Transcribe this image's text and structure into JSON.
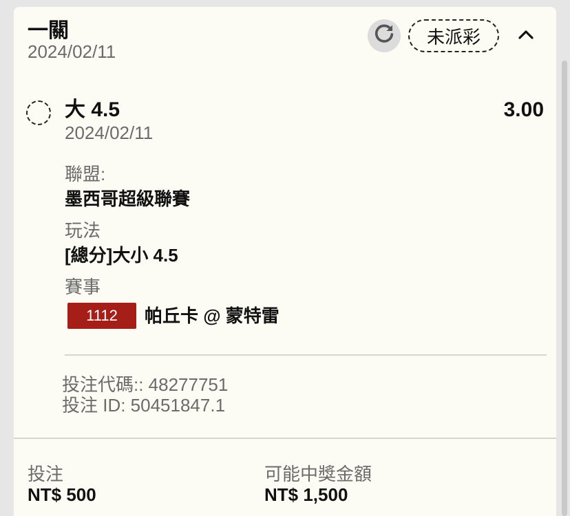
{
  "header": {
    "title": "一關",
    "date": "2024/02/11",
    "status": "未派彩"
  },
  "pick": {
    "name": "大 4.5",
    "odds": "3.00",
    "date": "2024/02/11"
  },
  "details": {
    "league_label": "聯盟:",
    "league_value": "墨西哥超級聯賽",
    "market_label": "玩法",
    "market_value": "[總分]大小 4.5",
    "event_label": "賽事",
    "event_id": "1112",
    "event_name": "帕丘卡 @ 蒙特雷"
  },
  "bet_info": {
    "code": "投注代碼:: 48277751",
    "id": "投注 ID: 50451847.1"
  },
  "footer": {
    "stake_label": "投注",
    "stake_value": "NT$ 500",
    "payout_label": "可能中獎金額",
    "payout_value": "NT$ 1,500"
  },
  "icons": {
    "refresh": "refresh-icon",
    "collapse": "chevron-up-icon"
  },
  "colors": {
    "card_bg": "#fcfcf5",
    "event_badge": "#a61e18",
    "muted_text": "#6b6b6b"
  }
}
